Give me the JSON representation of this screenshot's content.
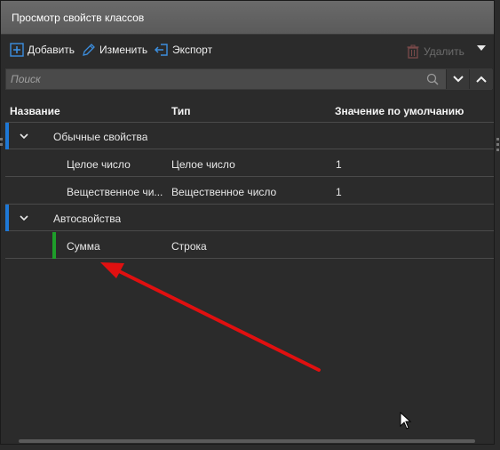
{
  "window": {
    "title": "Просмотр свойств классов"
  },
  "toolbar": {
    "add_label": "Добавить",
    "edit_label": "Изменить",
    "export_label": "Экспорт",
    "delete_label": "Удалить"
  },
  "search": {
    "placeholder": "Поиск"
  },
  "columns": {
    "name": "Название",
    "type": "Тип",
    "default": "Значение по умолчанию"
  },
  "rows": [
    {
      "kind": "group",
      "name": "Обычные свойства"
    },
    {
      "kind": "item",
      "name": "Целое число",
      "type": "Целое число",
      "default": "1"
    },
    {
      "kind": "item",
      "name": "Вещественное чи...",
      "type": "Вещественное число",
      "default": "1"
    },
    {
      "kind": "group",
      "name": "Автосвойства"
    },
    {
      "kind": "item",
      "name": "Сумма",
      "type": "Строка",
      "default": ""
    }
  ],
  "colors": {
    "accent_blue": "#1e78d6",
    "selected_green": "#1e9e2a",
    "annotation_red": "#e01010"
  }
}
